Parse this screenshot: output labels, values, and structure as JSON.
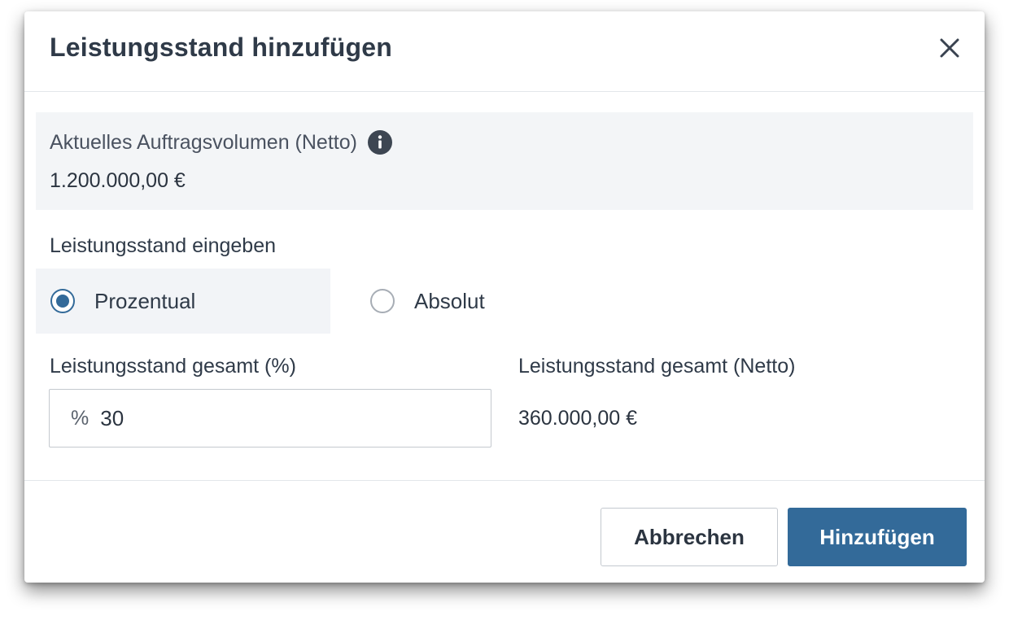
{
  "dialog": {
    "title": "Leistungsstand hinzufügen",
    "close_icon": "close-icon"
  },
  "info": {
    "label": "Aktuelles Auftragsvolumen (Netto)",
    "icon": "info-icon",
    "value": "1.200.000,00 €"
  },
  "entry": {
    "section_label": "Leistungsstand eingeben",
    "options": [
      {
        "label": "Prozentual",
        "selected": true
      },
      {
        "label": "Absolut",
        "selected": false
      }
    ]
  },
  "fields": {
    "percent_label": "Leistungsstand gesamt (%)",
    "percent_prefix": "%",
    "percent_value": "30",
    "net_label": "Leistungsstand gesamt (Netto)",
    "net_value": "360.000,00 €"
  },
  "footer": {
    "cancel_label": "Abbrechen",
    "add_label": "Hinzufügen"
  },
  "colors": {
    "accent": "#336a99",
    "info_bg": "#f3f5f7",
    "text": "#2f3a48"
  }
}
